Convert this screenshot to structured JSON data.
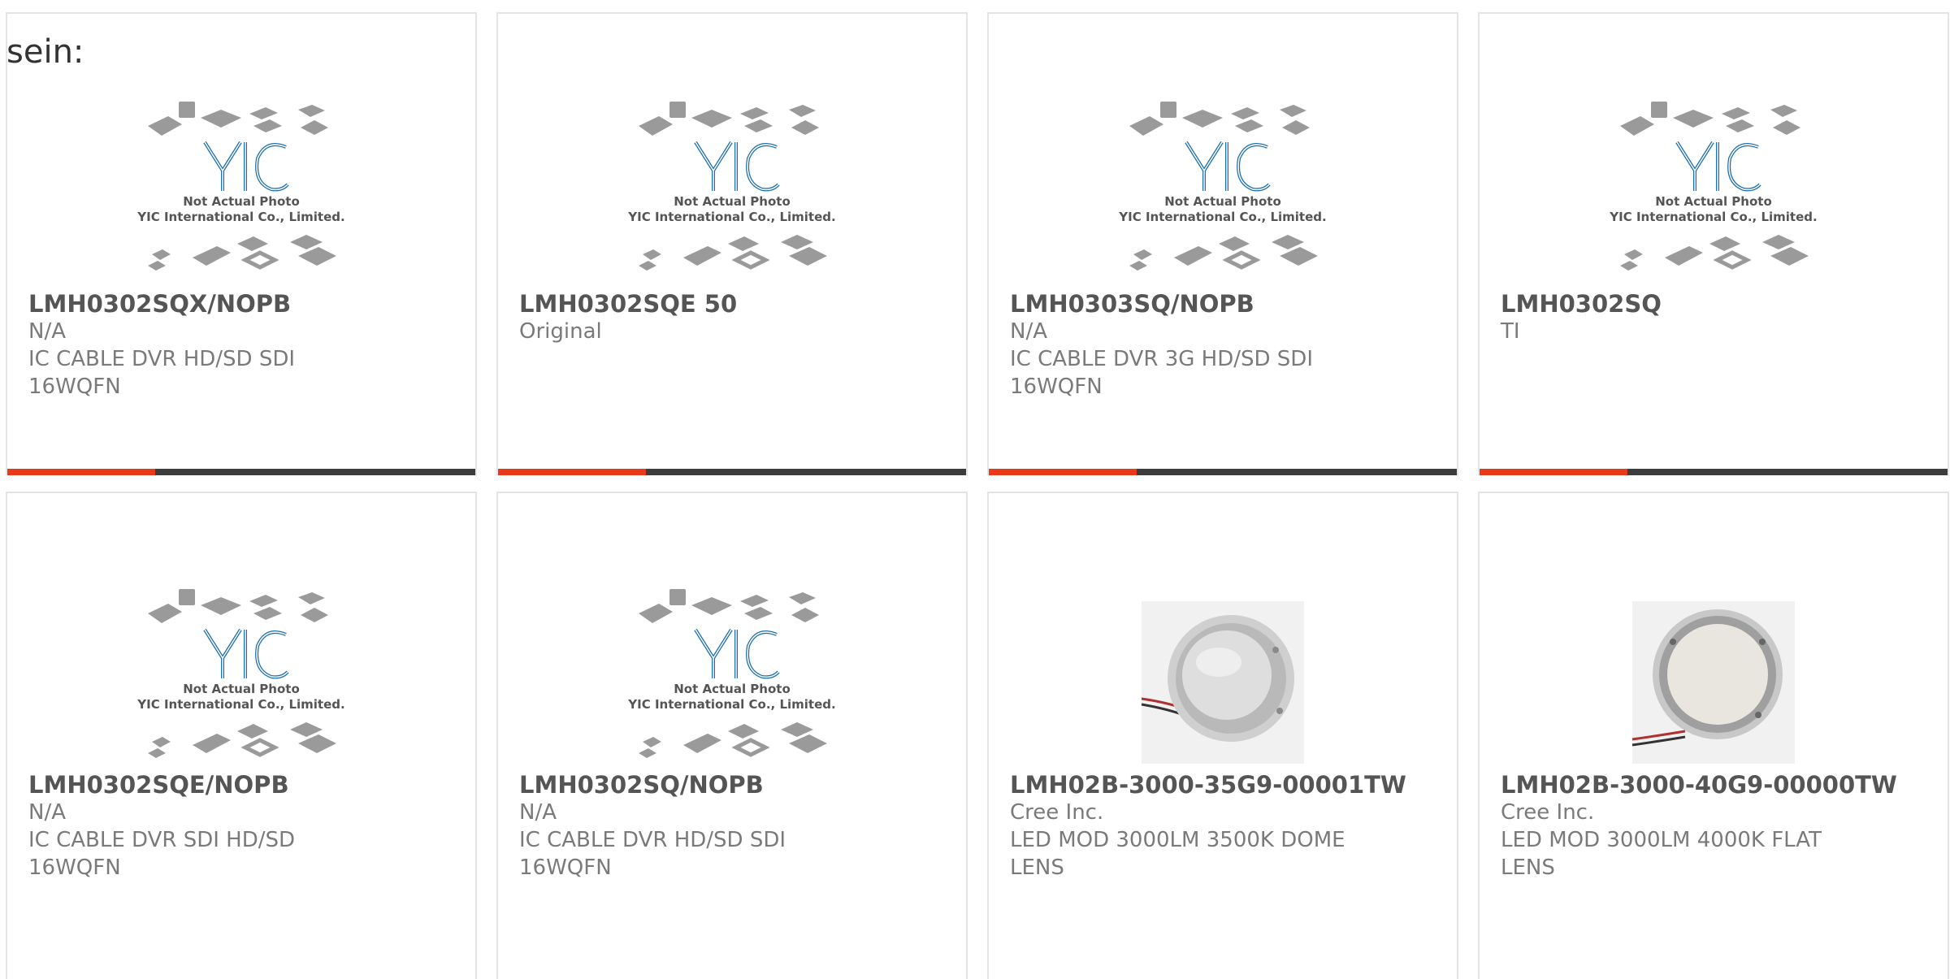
{
  "page": {
    "lead_text": "sein:"
  },
  "placeholder": {
    "line1": "Not Actual Photo",
    "line2": "YIC International Co., Limited.",
    "logo": "YIC"
  },
  "colors": {
    "accent": "#e8391a",
    "bar": "#3c3c3c",
    "logo_blue": "#1a6fb0"
  },
  "products": [
    {
      "part": "LMH0302SQX/NOPB",
      "sub": "N/A",
      "desc": "IC CABLE DVR HD/SD SDI 16WQFN",
      "image": "yic-placeholder",
      "has_bar": true
    },
    {
      "part": "LMH0302SQE 50",
      "sub": "Original",
      "desc": "",
      "image": "yic-placeholder",
      "has_bar": true
    },
    {
      "part": "LMH0303SQ/NOPB",
      "sub": "N/A",
      "desc": "IC CABLE DVR 3G HD/SD SDI 16WQFN",
      "image": "yic-placeholder",
      "has_bar": true
    },
    {
      "part": "LMH0302SQ",
      "sub": "TI",
      "desc": "",
      "image": "yic-placeholder",
      "has_bar": true
    },
    {
      "part": "LMH0302SQE/NOPB",
      "sub": "N/A",
      "desc": "IC CABLE DVR SDI HD/SD 16WQFN",
      "image": "yic-placeholder",
      "has_bar": false
    },
    {
      "part": "LMH0302SQ/NOPB",
      "sub": "N/A",
      "desc": "IC CABLE DVR HD/SD SDI 16WQFN",
      "image": "yic-placeholder",
      "has_bar": false
    },
    {
      "part": "LMH02B-3000-35G9-00001TW",
      "sub": "Cree Inc.",
      "desc": "LED MOD 3000LM 3500K DOME LENS",
      "image": "led-module-dome",
      "has_bar": false
    },
    {
      "part": "LMH02B-3000-40G9-00000TW",
      "sub": "Cree Inc.",
      "desc": "LED MOD 3000LM 4000K FLAT LENS",
      "image": "led-module-flat",
      "has_bar": false
    }
  ]
}
